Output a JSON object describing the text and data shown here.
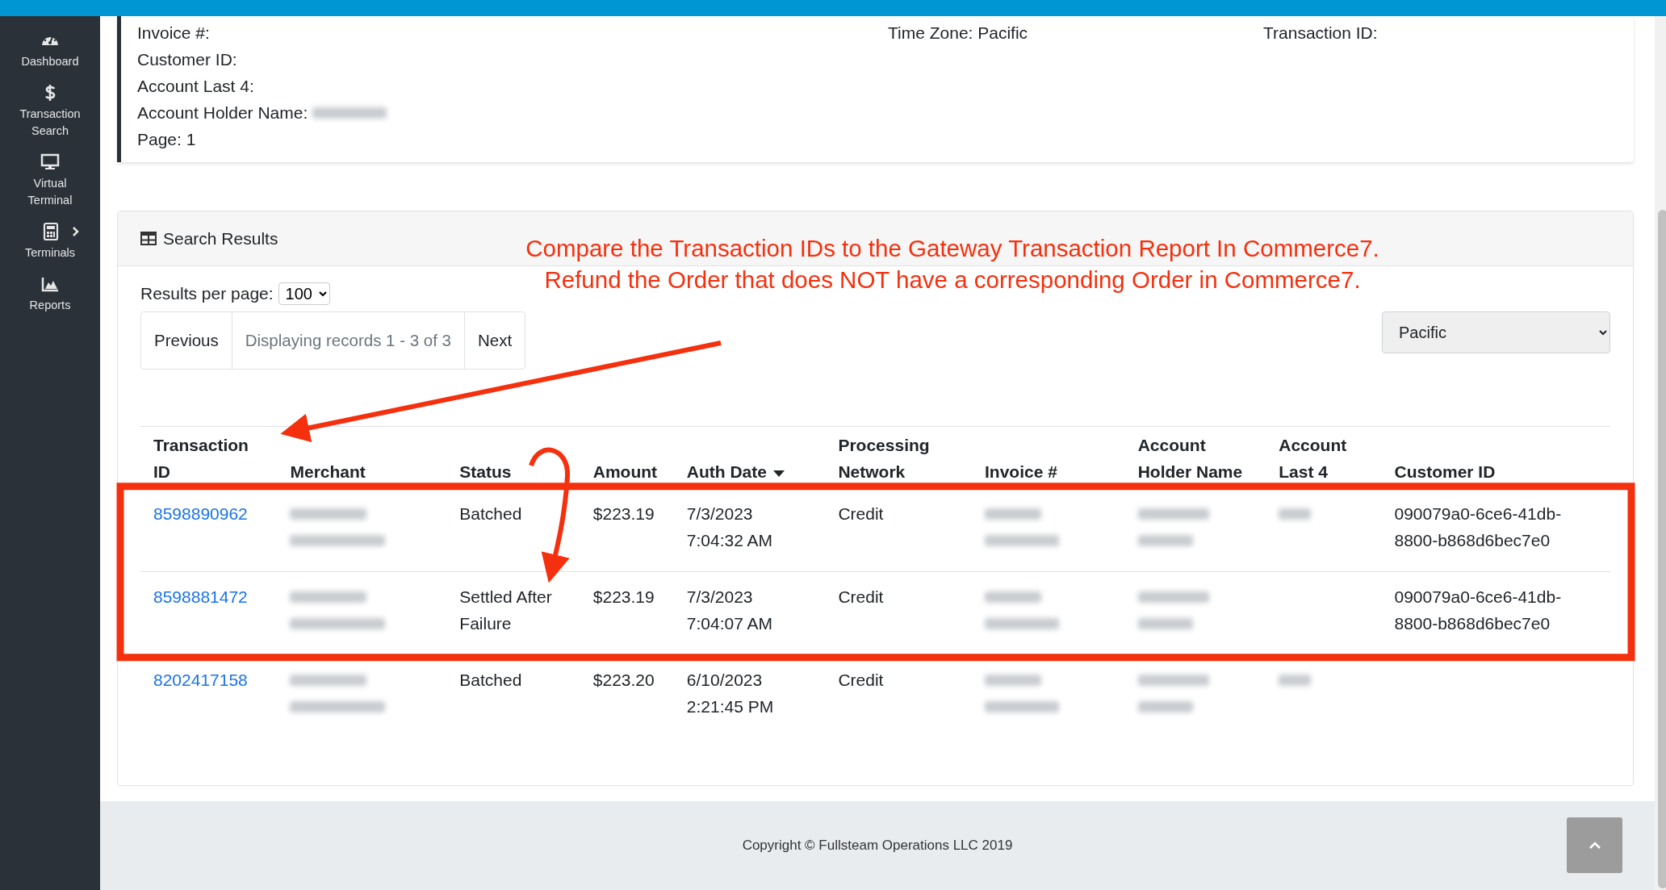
{
  "sidebar": {
    "items": [
      {
        "label": "Dashboard",
        "kind": "gauge",
        "expandable": false
      },
      {
        "label": "Transaction Search",
        "kind": "dollar",
        "expandable": false
      },
      {
        "label": "Virtual Terminal",
        "kind": "monitor",
        "expandable": false
      },
      {
        "label": "Terminals",
        "kind": "calculator",
        "expandable": true
      },
      {
        "label": "Reports",
        "kind": "chart",
        "expandable": false
      }
    ]
  },
  "filters": {
    "columns": [
      [
        {
          "label": "Invoice #:",
          "redacted": false
        },
        {
          "label": "Customer ID:",
          "redacted": false
        },
        {
          "label": "Account Last 4:",
          "redacted": false
        },
        {
          "label": "Account Holder Name:",
          "redacted": true
        },
        {
          "label": "Page: 1",
          "redacted": false
        }
      ],
      [
        {
          "label": "Time Zone: Pacific",
          "redacted": false
        }
      ],
      [
        {
          "label": "Transaction ID:",
          "redacted": false
        }
      ]
    ]
  },
  "results": {
    "title": "Search Results",
    "per_page_label": "Results per page:",
    "per_page_value": "100",
    "pager": {
      "previous": "Previous",
      "status": "Displaying records 1 - 3 of 3",
      "next": "Next"
    },
    "timezone": "Pacific",
    "columns": [
      {
        "label": "Transaction ID",
        "sorted": false
      },
      {
        "label": "Merchant",
        "sorted": false
      },
      {
        "label": "Status",
        "sorted": false
      },
      {
        "label": "Amount",
        "sorted": false
      },
      {
        "label": "Auth Date",
        "sorted": true
      },
      {
        "label": "Processing Network",
        "sorted": false
      },
      {
        "label": "Invoice #",
        "sorted": false
      },
      {
        "label": "Account Holder Name",
        "sorted": false
      },
      {
        "label": "Account Last 4",
        "sorted": false
      },
      {
        "label": "Customer ID",
        "sorted": false
      }
    ],
    "rows": [
      {
        "transaction_id": "8598890962",
        "status": "Batched",
        "amount": "$223.19",
        "auth_date": "7/3/2023 7:04:32 AM",
        "network": "Credit",
        "last4_redacted": true,
        "customer_id": "090079a0-6ce6-41db-8800-b868d6bec7e0"
      },
      {
        "transaction_id": "8598881472",
        "status": "Settled After Failure",
        "amount": "$223.19",
        "auth_date": "7/3/2023 7:04:07 AM",
        "network": "Credit",
        "last4_redacted": false,
        "customer_id": "090079a0-6ce6-41db-8800-b868d6bec7e0"
      },
      {
        "transaction_id": "8202417158",
        "status": "Batched",
        "amount": "$223.20",
        "auth_date": "6/10/2023 2:21:45 PM",
        "network": "Credit",
        "last4_redacted": true
      }
    ]
  },
  "annotation": {
    "lines": [
      "Compare the Transaction IDs to the Gateway Transaction Report In Commerce7.",
      "Refund the Order that does NOT have a corresponding Order in Commerce7."
    ]
  },
  "footer": {
    "copyright": "Copyright © Fullsteam Operations LLC 2019"
  }
}
